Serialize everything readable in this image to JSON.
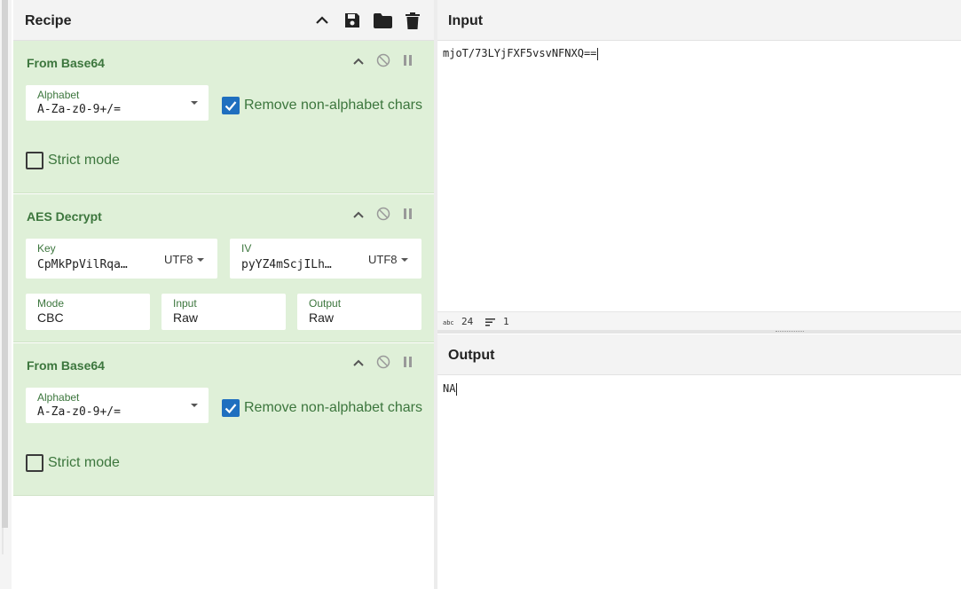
{
  "recipe": {
    "title": "Recipe",
    "ops": [
      {
        "title": "From Base64",
        "alphabet_label": "Alphabet",
        "alphabet_value": "A-Za-z0-9+/=",
        "remove_label": "Remove non-alphabet chars",
        "remove_checked": true,
        "strict_label": "Strict mode",
        "strict_checked": false
      },
      {
        "title": "AES Decrypt",
        "key_label": "Key",
        "key_value": "CpMkPpVilRqa…",
        "key_encoding": "UTF8",
        "iv_label": "IV",
        "iv_value": "pyYZ4mScjILh…",
        "iv_encoding": "UTF8",
        "mode_label": "Mode",
        "mode_value": "CBC",
        "input_label": "Input",
        "input_value": "Raw",
        "output_label": "Output",
        "output_value": "Raw"
      },
      {
        "title": "From Base64",
        "alphabet_label": "Alphabet",
        "alphabet_value": "A-Za-z0-9+/=",
        "remove_label": "Remove non-alphabet chars",
        "remove_checked": true,
        "strict_label": "Strict mode",
        "strict_checked": false
      }
    ]
  },
  "input": {
    "title": "Input",
    "text": "mjoT/73LYjFXF5vsvNFNXQ==",
    "status_length": "24",
    "status_lines": "1"
  },
  "output": {
    "title": "Output",
    "text": "NA"
  },
  "colors": {
    "op_background": "#dff0d8",
    "op_text": "#3c763d",
    "checkbox_checked": "#1f6fbf"
  }
}
